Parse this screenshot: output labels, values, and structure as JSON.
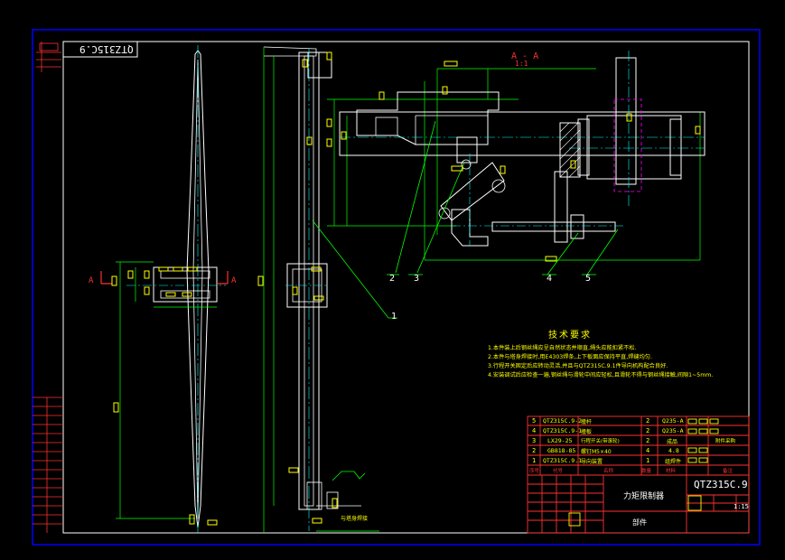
{
  "drawing": {
    "code_stamp": "QTZ315C.9",
    "section_label": "A - A",
    "section_scale": "1:1",
    "cut_marks": [
      "A",
      "A"
    ],
    "callouts": [
      "1",
      "2",
      "3",
      "4",
      "5"
    ]
  },
  "notes": {
    "heading": "技术要求",
    "items": [
      "1.本件装上后钢丝绳应呈自然状态并顺直,绳头应能扣紧不松.",
      "2.本件与塔身焊接时,用E4303焊条,上下板面应保持平直,焊缝均匀.",
      "3.行程开关固定后应转动灵活,并且与QTZ315C.9.1件导向机构配合良好.",
      "4.安装调试后应检查一遍,钢丝绳与滑轮中间应轻松,且滑轮不得与钢丝绳接触,间隙1~5mm."
    ]
  },
  "title_block": {
    "rows": [
      {
        "no": "5",
        "code": "QTZ315C.9-2",
        "name": "撞杆",
        "qty": "2",
        "material": "Q235-A",
        "remark": ""
      },
      {
        "no": "4",
        "code": "QTZ315C.9-1",
        "name": "撞板",
        "qty": "2",
        "material": "Q235-A",
        "remark": ""
      },
      {
        "no": "3",
        "code": "LX29-25",
        "name": "行程开关(带滚轮)",
        "qty": "2",
        "material": "成品",
        "remark": "附件采购"
      },
      {
        "no": "2",
        "code": "GB818-85",
        "name": "螺钉M5×40",
        "qty": "4",
        "material": "4.8",
        "remark": ""
      },
      {
        "no": "1",
        "code": "QTZ315C.9.1",
        "name": "导向装置",
        "qty": "1",
        "material": "组焊件",
        "remark": ""
      }
    ],
    "header": [
      "序号",
      "代号",
      "名称",
      "数量",
      "材料",
      "备注"
    ],
    "drawing_title": "力矩限制器",
    "drawing_code": "QTZ315C.9",
    "sheet_type": "部件",
    "scale": "1:15"
  },
  "weld_note": "与塔身焊接",
  "colors": {
    "background": "#000000",
    "frame": "#0000ff",
    "border": "#ffffff",
    "geometry": "#ffffff",
    "centerline": "#00ffff",
    "dimension": "#00ff00",
    "text_yellow": "#ffff00",
    "title_red": "#ff3030",
    "hidden": "#ff00ff"
  }
}
